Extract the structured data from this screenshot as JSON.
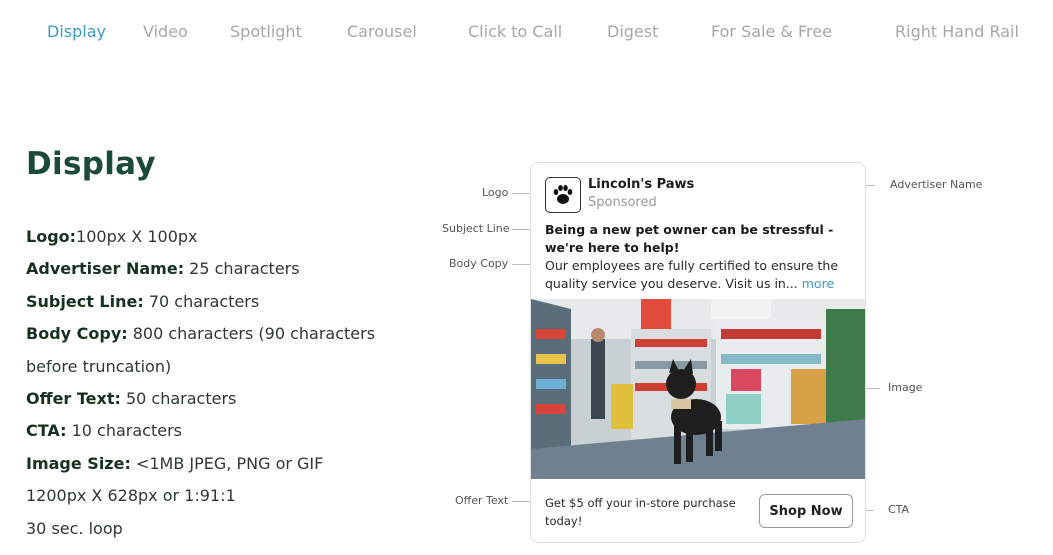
{
  "tabs": [
    {
      "label": "Display",
      "active": true
    },
    {
      "label": "Video"
    },
    {
      "label": "Spotlight"
    },
    {
      "label": "Carousel"
    },
    {
      "label": "Click to Call"
    },
    {
      "label": "Digest"
    },
    {
      "label": "For Sale & Free"
    },
    {
      "label": "Right Hand Rail"
    }
  ],
  "colors": {
    "active_tab": "#3c9bc4",
    "inactive_tab": "#a3a9ab",
    "title": "#1b4a3a",
    "link": "#3c9bc4"
  },
  "spec": {
    "title": "Display",
    "lines": [
      {
        "label": "Logo:",
        "value": "100px X 100px"
      },
      {
        "label": "Advertiser Name:",
        "value": " 25 characters"
      },
      {
        "label": "Subject Line:",
        "value": " 70 characters"
      },
      {
        "label": "Body Copy:",
        "value": " 800 characters (90 characters"
      },
      {
        "label": "",
        "value": "before truncation)"
      },
      {
        "label": "Offer Text:",
        "value": " 50 characters"
      },
      {
        "label": "CTA:",
        "value": " 10 characters"
      },
      {
        "label": "Image Size:",
        "value": " <1MB JPEG, PNG or GIF"
      },
      {
        "label": "",
        "value": "1200px X 628px or 1:91:1"
      },
      {
        "label": "",
        "value": "30 sec. loop"
      }
    ]
  },
  "ad": {
    "logo_icon": "paw-icon",
    "advertiser_name": "Lincoln's Paws",
    "sponsored": "Sponsored",
    "subject_line": "Being a new pet owner can be stressful - we're here to help!",
    "body_copy": "Our employees are fully certified to ensure the quality service you deserve. Visit us in...",
    "more_link": "more",
    "image_alt": "dog-in-pet-store-image",
    "offer_text": "Get $5 off your in-store purchase today!",
    "cta_label": "Shop Now"
  },
  "annotations": {
    "logo": "Logo",
    "subject_line": "Subject Line",
    "body_copy": "Body Copy",
    "offer_text": "Offer Text",
    "advertiser_name": "Advertiser Name",
    "image": "Image",
    "cta": "CTA"
  }
}
